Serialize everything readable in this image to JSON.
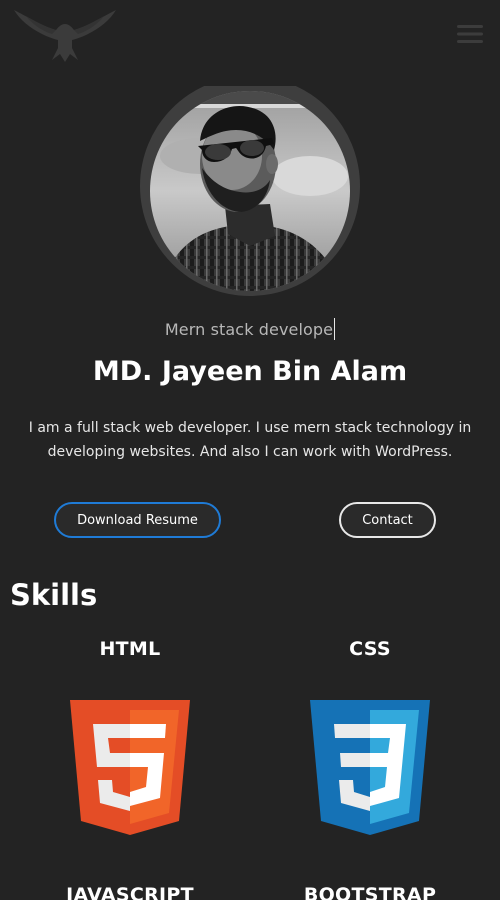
{
  "header": {
    "logo_icon": "eagle-logo-icon",
    "menu_icon": "hamburger-menu-icon"
  },
  "hero": {
    "avatar_icon": "profile-photo",
    "subtitle": "Mern stack develope",
    "name": "MD. Jayeen Bin Alam",
    "bio": "I am a full stack web developer. I use mern stack technology in developing websites. And also I can work with WordPress."
  },
  "actions": {
    "resume_label": "Download Resume",
    "contact_label": "Contact"
  },
  "skills": {
    "heading": "Skills",
    "items": [
      {
        "label": "HTML",
        "icon": "html5-icon"
      },
      {
        "label": "CSS",
        "icon": "css3-icon"
      },
      {
        "label": "JAVASCRIPT",
        "icon": "javascript-icon"
      },
      {
        "label": "BOOTSTRAP",
        "icon": "bootstrap-icon"
      }
    ]
  },
  "colors": {
    "background": "#232323",
    "resume_border": "#1f7bd6",
    "contact_border": "#e8e8e8",
    "html_orange": "#e44d26",
    "css_blue": "#1572b6"
  }
}
